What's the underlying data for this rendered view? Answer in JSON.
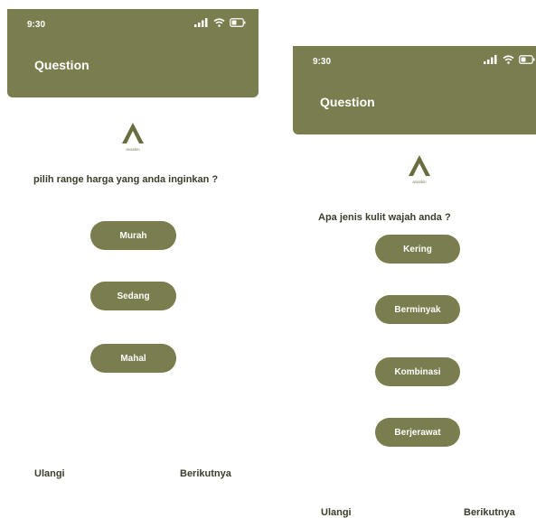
{
  "colors": {
    "accent": "#7a7d4d",
    "text_dark": "#3c3d2c",
    "background": "#ffffff"
  },
  "screens": [
    {
      "status_time": "9:30",
      "title": "Question",
      "brand": "avaskin",
      "question": "pilih range harga yang anda inginkan ?",
      "options": [
        "Murah",
        "Sedang",
        "Mahal"
      ],
      "back_label": "Ulangi",
      "next_label": "Berikutnya"
    },
    {
      "status_time": "9:30",
      "title": "Question",
      "brand": "avaskin",
      "question": "Apa jenis kulit wajah anda ?",
      "options": [
        "Kering",
        "Berminyak",
        "Kombinasi",
        "Berjerawat"
      ],
      "back_label": "Ulangi",
      "next_label": "Berikutnya"
    }
  ],
  "icons": [
    "signal-icon",
    "wifi-icon",
    "battery-icon",
    "avaskin-logo"
  ]
}
